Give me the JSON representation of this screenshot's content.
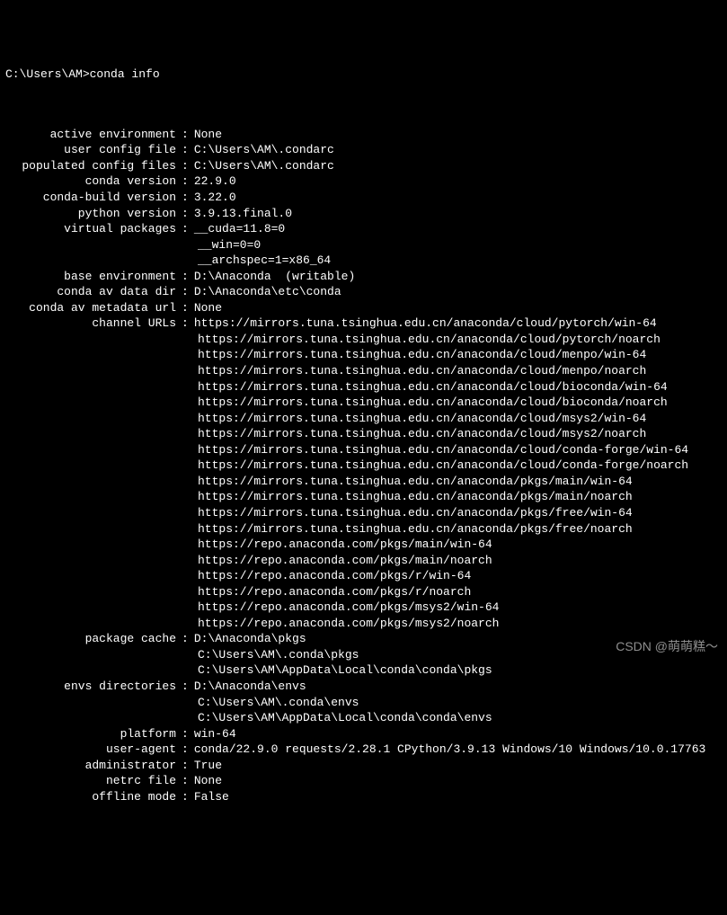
{
  "prompt": "C:\\Users\\AM>",
  "command": "conda info",
  "rows": [
    {
      "label": "active environment",
      "value": "None"
    },
    {
      "label": "user config file",
      "value": "C:\\Users\\AM\\.condarc"
    },
    {
      "label": "populated config files",
      "value": "C:\\Users\\AM\\.condarc"
    },
    {
      "label": "conda version",
      "value": "22.9.0"
    },
    {
      "label": "conda-build version",
      "value": "3.22.0"
    },
    {
      "label": "python version",
      "value": "3.9.13.final.0"
    },
    {
      "label": "virtual packages",
      "value": "__cuda=11.8=0",
      "extra": [
        "__win=0=0",
        "__archspec=1=x86_64"
      ]
    },
    {
      "label": "base environment",
      "value": "D:\\Anaconda  (writable)"
    },
    {
      "label": "conda av data dir",
      "value": "D:\\Anaconda\\etc\\conda"
    },
    {
      "label": "conda av metadata url",
      "value": "None"
    },
    {
      "label": "channel URLs",
      "value": "https://mirrors.tuna.tsinghua.edu.cn/anaconda/cloud/pytorch/win-64",
      "extra": [
        "https://mirrors.tuna.tsinghua.edu.cn/anaconda/cloud/pytorch/noarch",
        "https://mirrors.tuna.tsinghua.edu.cn/anaconda/cloud/menpo/win-64",
        "https://mirrors.tuna.tsinghua.edu.cn/anaconda/cloud/menpo/noarch",
        "https://mirrors.tuna.tsinghua.edu.cn/anaconda/cloud/bioconda/win-64",
        "https://mirrors.tuna.tsinghua.edu.cn/anaconda/cloud/bioconda/noarch",
        "https://mirrors.tuna.tsinghua.edu.cn/anaconda/cloud/msys2/win-64",
        "https://mirrors.tuna.tsinghua.edu.cn/anaconda/cloud/msys2/noarch",
        "https://mirrors.tuna.tsinghua.edu.cn/anaconda/cloud/conda-forge/win-64",
        "https://mirrors.tuna.tsinghua.edu.cn/anaconda/cloud/conda-forge/noarch",
        "https://mirrors.tuna.tsinghua.edu.cn/anaconda/pkgs/main/win-64",
        "https://mirrors.tuna.tsinghua.edu.cn/anaconda/pkgs/main/noarch",
        "https://mirrors.tuna.tsinghua.edu.cn/anaconda/pkgs/free/win-64",
        "https://mirrors.tuna.tsinghua.edu.cn/anaconda/pkgs/free/noarch",
        "https://repo.anaconda.com/pkgs/main/win-64",
        "https://repo.anaconda.com/pkgs/main/noarch",
        "https://repo.anaconda.com/pkgs/r/win-64",
        "https://repo.anaconda.com/pkgs/r/noarch",
        "https://repo.anaconda.com/pkgs/msys2/win-64",
        "https://repo.anaconda.com/pkgs/msys2/noarch"
      ]
    },
    {
      "label": "package cache",
      "value": "D:\\Anaconda\\pkgs",
      "extra": [
        "C:\\Users\\AM\\.conda\\pkgs",
        "C:\\Users\\AM\\AppData\\Local\\conda\\conda\\pkgs"
      ]
    },
    {
      "label": "envs directories",
      "value": "D:\\Anaconda\\envs",
      "extra": [
        "C:\\Users\\AM\\.conda\\envs",
        "C:\\Users\\AM\\AppData\\Local\\conda\\conda\\envs"
      ]
    },
    {
      "label": "platform",
      "value": "win-64"
    },
    {
      "label": "user-agent",
      "value": "conda/22.9.0 requests/2.28.1 CPython/3.9.13 Windows/10 Windows/10.0.17763"
    },
    {
      "label": "administrator",
      "value": "True"
    },
    {
      "label": "netrc file",
      "value": "None"
    },
    {
      "label": "offline mode",
      "value": "False"
    }
  ],
  "watermark": "CSDN @萌萌糕～"
}
